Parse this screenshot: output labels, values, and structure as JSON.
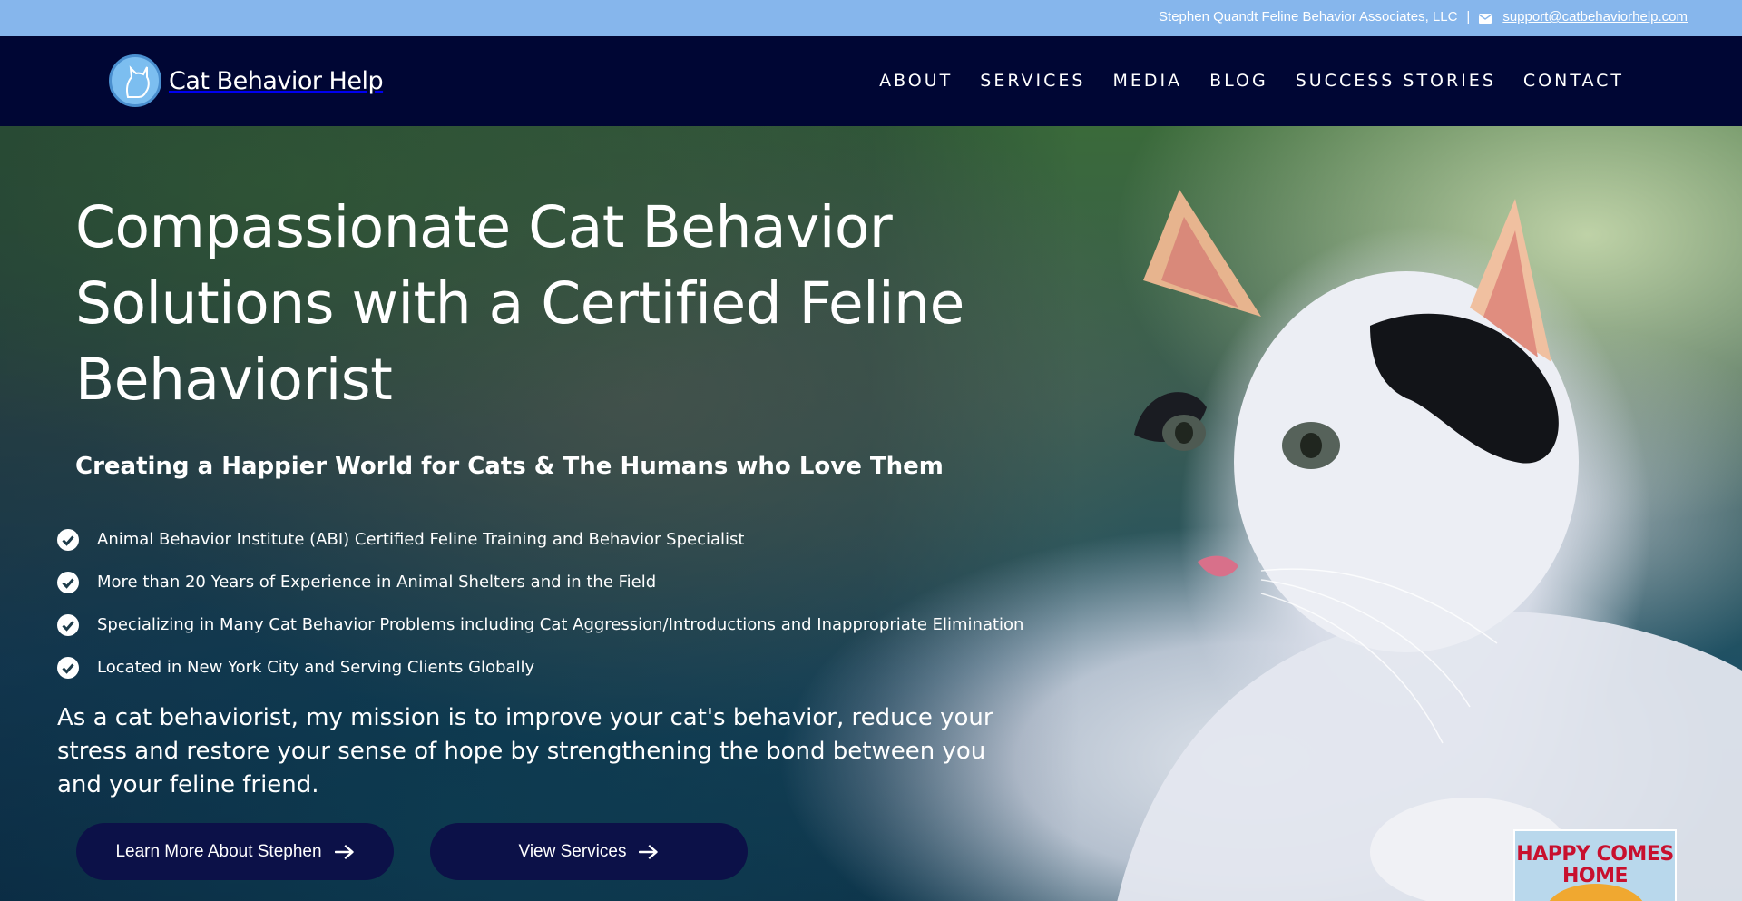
{
  "topbar": {
    "company": "Stephen Quandt Feline Behavior Associates, LLC",
    "separator": "|",
    "email": "support@catbehaviorhelp.com",
    "mail_icon": "envelope-icon"
  },
  "header": {
    "logo_text": "Cat Behavior Help",
    "logo_icon": "cat-silhouette-logo",
    "nav": [
      {
        "label": "ABOUT"
      },
      {
        "label": "SERVICES"
      },
      {
        "label": "MEDIA"
      },
      {
        "label": "BLOG"
      },
      {
        "label": "SUCCESS STORIES"
      },
      {
        "label": "CONTACT"
      }
    ]
  },
  "hero": {
    "title": "Compassionate Cat Behavior Solutions with a Certified Feline Behaviorist",
    "subtitle": "Creating a Happier World for Cats & The Humans who Love Them",
    "checklist": [
      {
        "text": "Animal Behavior Institute (ABI) Certified Feline Training and Behavior Specialist"
      },
      {
        "text": "More than 20 Years of Experience in Animal Shelters and in the Field"
      },
      {
        "text": "Specializing in Many Cat Behavior Problems including Cat Aggression/Introductions and Inappropriate Elimination"
      },
      {
        "text": "Located in New York City and Serving Clients Globally"
      }
    ],
    "mission": "As a cat behaviorist, my mission is to improve your cat's behavior, reduce your stress and restore your sense of hope by strengthening the bond between you and your feline friend.",
    "buttons": [
      {
        "label": "Learn More About Stephen",
        "icon": "arrow-right-icon"
      },
      {
        "label": "View Services",
        "icon": "arrow-right-icon"
      }
    ],
    "book_badge": "HAPPY COMES HOME"
  },
  "colors": {
    "topbar_bg": "#86b6ec",
    "header_bg": "#000634",
    "button_bg": "#0c1148",
    "text": "#ffffff"
  }
}
